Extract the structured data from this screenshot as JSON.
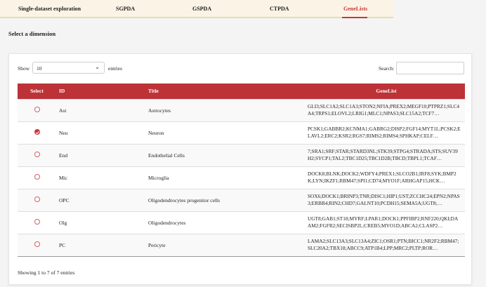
{
  "tabs": [
    {
      "label": "Single-dataset exploration",
      "active": false
    },
    {
      "label": "SGPDA",
      "active": false
    },
    {
      "label": "GSPDA",
      "active": false
    },
    {
      "label": "CTPDA",
      "active": false
    },
    {
      "label": "GeneLists",
      "active": true
    }
  ],
  "heading": "Select a dimension",
  "controls": {
    "show_label": "Show",
    "length_value": "10",
    "entries_label": "entries",
    "search_label": "Search:",
    "search_value": ""
  },
  "table": {
    "columns": [
      "Select",
      "ID",
      "Title",
      "GeneList"
    ],
    "rows": [
      {
        "selected": false,
        "id": "Ast",
        "title": "Astrocytes",
        "genes": "GLI3;SLC1A2;SLC1A3;STON2;NFIA;PREX2;MEGF10;PTPRZ1;SLC4A4;TRPS1;ELOVL2;LRIG1;MLC1;NPAS3;SLC15A2;TCF7…"
      },
      {
        "selected": true,
        "id": "Neu",
        "title": "Neuron",
        "genes": "PCSK1;GABBR2;KCNMA1;GABRG2;DISP2;FGF14;MYT1L;PCSK2;ELAVL2;ERC2;KSR2;RGS7;RIMS2;RIMS4;SPHKAP;CELF…"
      },
      {
        "selected": false,
        "id": "End",
        "title": "Endothelial Cells",
        "genes": "7;SRA1;SRF;STAR;STARD3NL;STK39;STPG4;STRADA;STS;SUV39H2;SYCP1;TAL2;TBC1D25;TBC1D2B;TBCD;TBPL1;TCAF…"
      },
      {
        "selected": false,
        "id": "Mic",
        "title": "Microglia",
        "genes": "DOCK8;BLNK;DOCK2;WDFY4;PREX1;SLCO2B1;IRF8;SYK;BMP2K;LYN;IKZF1;RBM47;SPI1;CD74;MYO1F;ARHGAP15;HCK…"
      },
      {
        "selected": false,
        "id": "OPC",
        "title": "Oligodendrocytes progenitor cells",
        "genes": "SOX6;DOCK1;BRINP3;TNR;DISC1;HIP1;UST;ZCCHC24;EPN2;NPAS3;ERBB4;RIN2;CHD7;GALNT10;PCDH15;SEMA5A;UGT8;…"
      },
      {
        "selected": false,
        "id": "Olg",
        "title": "Oligodendrocytes",
        "genes": "UGT8;GAB1;ST18;MYRF;LPAR1;DOCK1;PPFIBP2;RNF220;QKI;DAAM2;FGFR2;SECISBP2L;CREB5;MYO1D;ABCA2;CLASP2…"
      },
      {
        "selected": false,
        "id": "PC",
        "title": "Pericyte",
        "genes": "LAMA2;SLC13A3;SLC13A4;ZIC1;OSR1;PTN;BICC1;NR2F2;RBM47;SLC20A2;TBX18;ABCC9;ATP1B4;LPP;MRC2;PLTP;ROR…"
      }
    ]
  },
  "info": "Showing 1 to 7 of 7 entries",
  "colors": {
    "accent": "#bd3237",
    "tab_bar": "#fbf4e6"
  }
}
